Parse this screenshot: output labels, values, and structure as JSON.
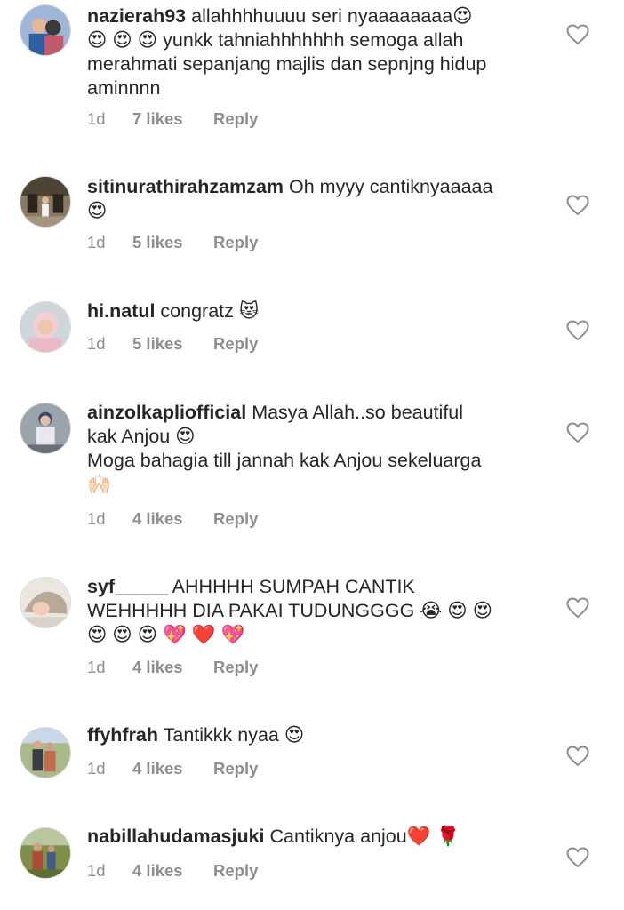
{
  "comments": [
    {
      "username": "nazierah93",
      "lines": [
        "allahhhhuuuu seri nyaaaaaaaa😍",
        "😍 😍 😍 yunkk tahniahhhhhhh semoga allah",
        "merahmati sepanjang majlis dan sepnjng hidup",
        "aminnnn"
      ],
      "time": "1d",
      "likes": "7 likes",
      "reply": "Reply",
      "avatar_color": "#3d6fb0"
    },
    {
      "username": "sitinurathirahzamzam",
      "lines": [
        "Oh myyy cantiknyaaaaa",
        "😍"
      ],
      "time": "1d",
      "likes": "5 likes",
      "reply": "Reply",
      "avatar_color": "#6b5a43"
    },
    {
      "username": "hi.natul",
      "lines": [
        "congratz 😻"
      ],
      "time": "1d",
      "likes": "5 likes",
      "reply": "Reply",
      "avatar_color": "#e8c7cf"
    },
    {
      "username": "ainzolkapliofficial",
      "lines": [
        "Masya Allah..so beautiful",
        "kak Anjou 😍",
        "Moga bahagia till jannah kak Anjou sekeluarga",
        "🙌🏻"
      ],
      "time": "1d",
      "likes": "4 likes",
      "reply": "Reply",
      "avatar_color": "#5a6a7c"
    },
    {
      "username": "syf_____",
      "lines": [
        "AHHHHH SUMPAH CANTIK",
        "WEHHHHH DIA PAKAI TUDUNGGGG 😭 😍 😍",
        "😍 😍 😍 💖 ❤️ 💖"
      ],
      "time": "1d",
      "likes": "4 likes",
      "reply": "Reply",
      "avatar_color": "#d8cfc4"
    },
    {
      "username": "ffyhfrah",
      "lines": [
        "Tantikkk nyaa 😍"
      ],
      "time": "1d",
      "likes": "4 likes",
      "reply": "Reply",
      "avatar_color": "#7a8b55"
    },
    {
      "username": "nabillahudamasjuki",
      "lines": [
        "Cantiknya anjou❤️ 🌹"
      ],
      "time": "1d",
      "likes": "4 likes",
      "reply": "Reply",
      "avatar_color": "#6f7a3a"
    }
  ],
  "colors": {
    "text": "#262626",
    "meta": "#8e8e8e",
    "heart_stroke": "#8e8e8e",
    "background": "#ffffff"
  },
  "icons": {
    "like": "heart-outline-icon",
    "avatar": "profile-photo"
  }
}
